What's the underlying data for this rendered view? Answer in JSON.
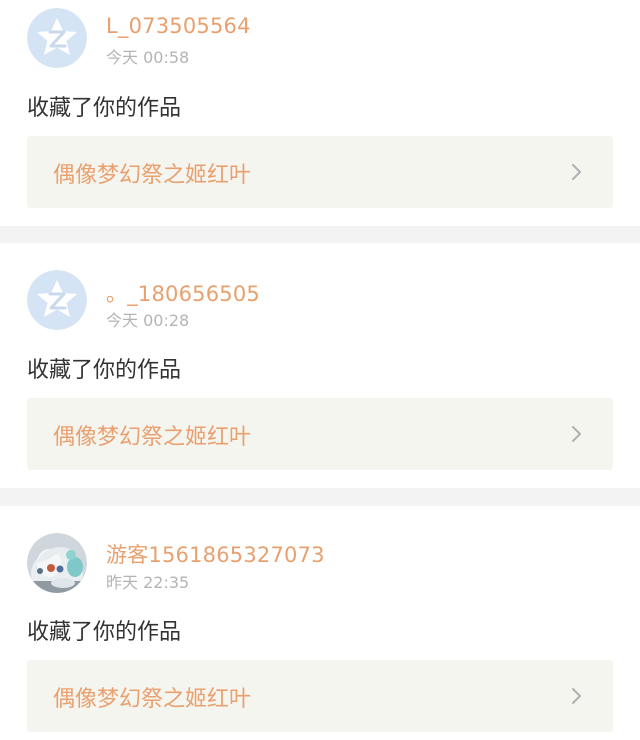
{
  "notifications": [
    {
      "username": "L_073505564",
      "time": "今天 00:58",
      "action": "收藏了你的作品",
      "work_title": "偶像梦幻祭之姬红叶",
      "avatar_icon": "default-star-avatar-icon"
    },
    {
      "username": "。_180656505",
      "time": "今天 00:28",
      "action": "收藏了你的作品",
      "work_title": "偶像梦幻祭之姬红叶",
      "avatar_icon": "default-star-avatar-icon"
    },
    {
      "username": "游客1561865327073",
      "time": "昨天 22:35",
      "action": "收藏了你的作品",
      "work_title": "偶像梦幻祭之姬红叶",
      "avatar_icon": "user-photo-avatar"
    }
  ],
  "colors": {
    "username": "#e9a06f",
    "work_title": "#e9a06f",
    "time": "#b4b4b4",
    "action_text": "#333333",
    "work_link_bg": "#f5f5ef",
    "separator_bg": "#f3f3f3",
    "default_avatar_bg": "#d5e4f5"
  }
}
